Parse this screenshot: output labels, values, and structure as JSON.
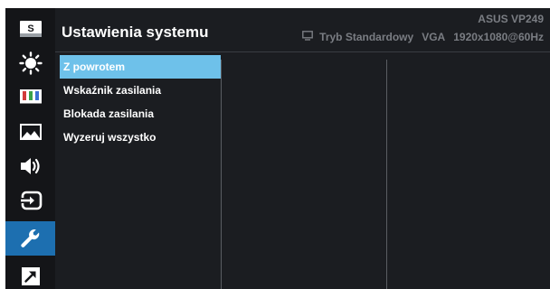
{
  "header": {
    "title": "Ustawienia systemu",
    "model": "ASUS  VP249",
    "mode": "Tryb Standardowy",
    "input": "VGA",
    "resolution": "1920x1080@60Hz"
  },
  "sidebar": {
    "items": [
      {
        "icon": "splendid-s-icon",
        "active": false
      },
      {
        "icon": "brightness-sun-icon",
        "active": false
      },
      {
        "icon": "color-bars-icon",
        "active": false
      },
      {
        "icon": "image-landscape-icon",
        "active": false
      },
      {
        "icon": "speaker-icon",
        "active": false
      },
      {
        "icon": "input-select-icon",
        "active": false
      },
      {
        "icon": "wrench-icon",
        "active": true
      },
      {
        "icon": "shortcut-arrow-icon",
        "active": false
      }
    ]
  },
  "menu": {
    "items": [
      {
        "label": "Z powrotem",
        "selected": true
      },
      {
        "label": "Wskaźnik zasilania",
        "selected": false
      },
      {
        "label": "Blokada zasilania",
        "selected": false
      },
      {
        "label": "Wyzeruj wszystko",
        "selected": false
      }
    ]
  },
  "colors": {
    "background": "#1b1d21",
    "rail": "#141518",
    "active_tab": "#1d6fb0",
    "selected_item": "#6ec1ea",
    "muted_text": "#7a7d83"
  }
}
